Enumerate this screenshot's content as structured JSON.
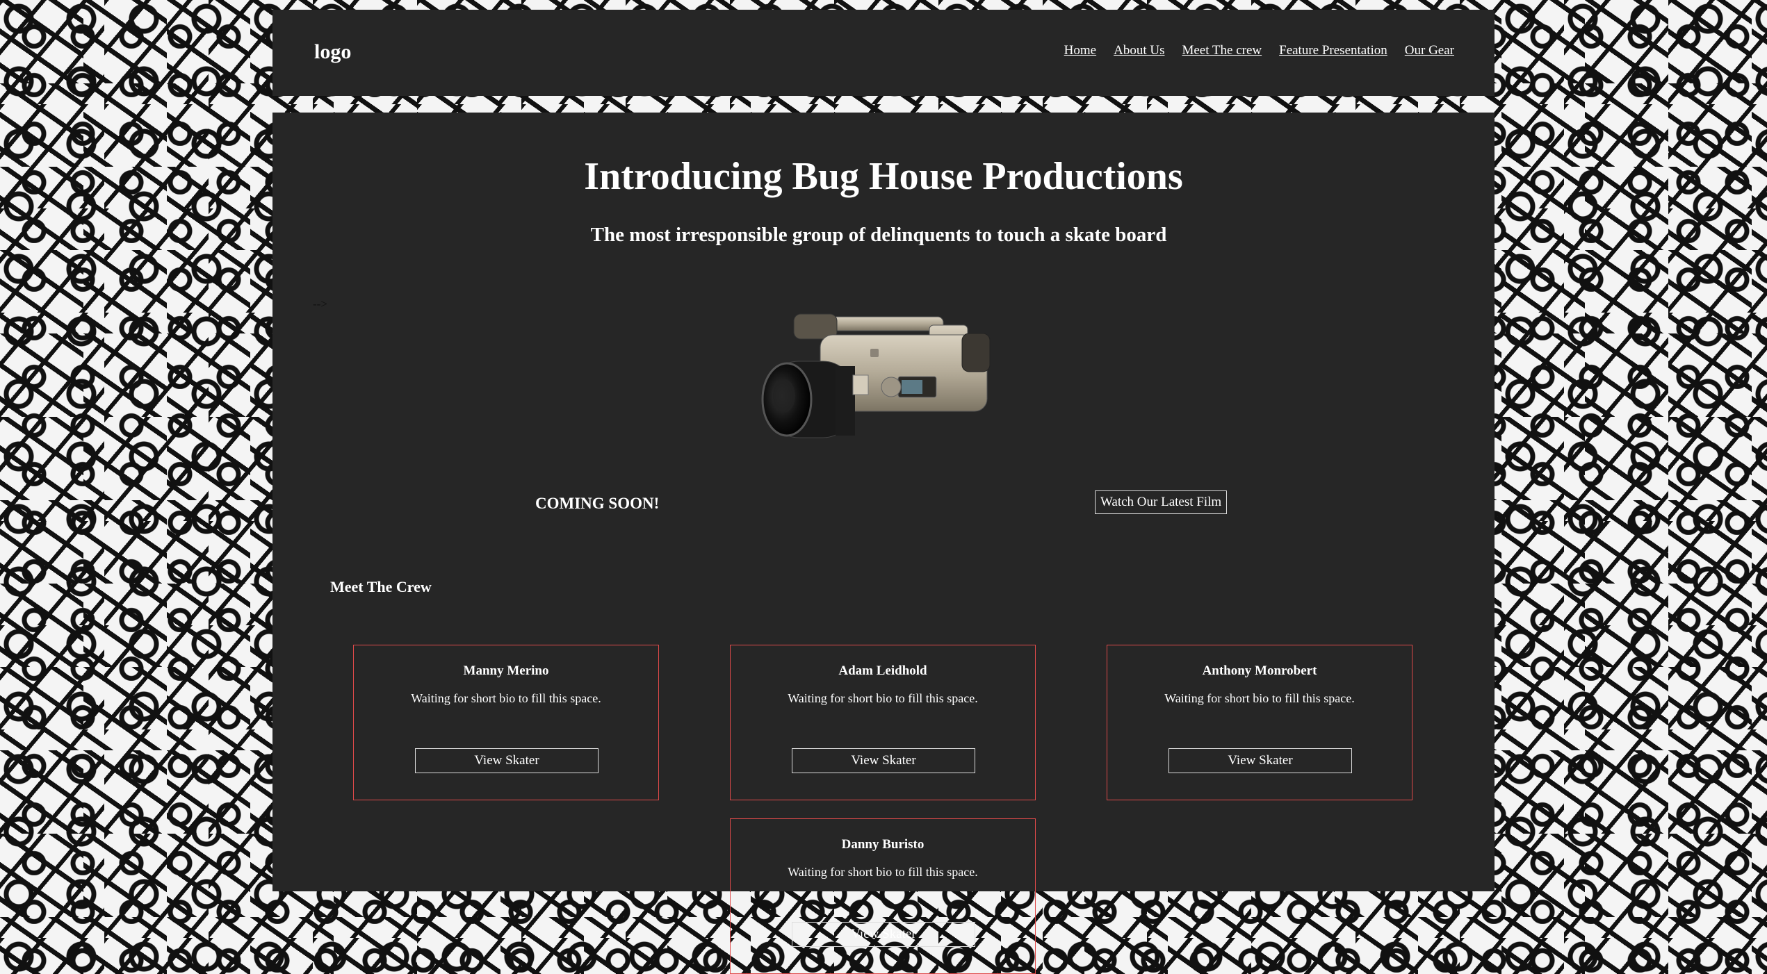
{
  "header": {
    "logo": "logo",
    "nav": [
      "Home",
      "About Us",
      "Meet The crew",
      "Feature Presentation",
      "Our Gear"
    ]
  },
  "hero": {
    "title": "Introducing Bug House Productions",
    "subtitle": "The most irresponsible group of delinquents to touch a skate board",
    "stray_text": "-->",
    "coming_soon": "COMING SOON!",
    "watch_button": "Watch Our Latest Film"
  },
  "crew": {
    "title": "Meet The Crew",
    "members": [
      {
        "name": "Manny Merino",
        "bio": "Waiting for short bio to fill this space.",
        "button": "View Skater"
      },
      {
        "name": "Adam Leidhold",
        "bio": "Waiting for short bio to fill this space.",
        "button": "View Skater"
      },
      {
        "name": "Anthony Monrobert",
        "bio": "Waiting for short bio to fill this space.",
        "button": "View Skater"
      },
      {
        "name": "Danny Buristo",
        "bio": "Waiting for short bio to fill this space.",
        "button": "View Skater"
      }
    ]
  },
  "colors": {
    "panel": "#262626",
    "card_border": "#e04a4a",
    "pattern": "#111111"
  },
  "icons": {
    "hero_image": "camcorder-image"
  }
}
